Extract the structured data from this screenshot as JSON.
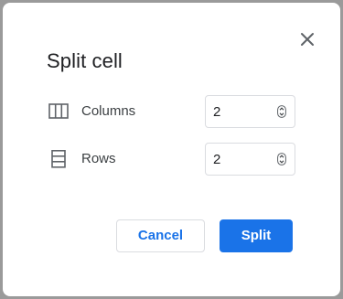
{
  "dialog": {
    "title": "Split cell",
    "close_icon": "close-icon"
  },
  "fields": {
    "columns": {
      "label": "Columns",
      "value": "2",
      "icon": "columns-icon"
    },
    "rows": {
      "label": "Rows",
      "value": "2",
      "icon": "rows-icon"
    }
  },
  "actions": {
    "cancel_label": "Cancel",
    "split_label": "Split"
  },
  "colors": {
    "accent": "#1a73e8",
    "text": "#202124",
    "border": "#dadce0"
  }
}
